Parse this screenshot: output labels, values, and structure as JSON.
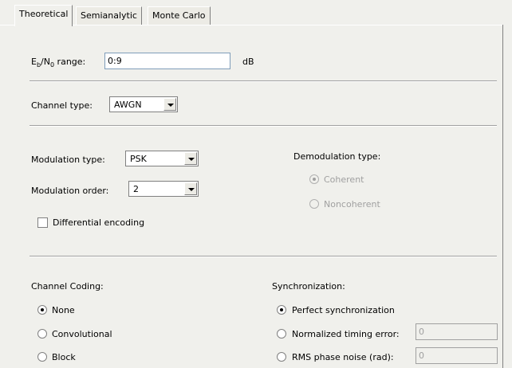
{
  "tabs": [
    {
      "label": "Theoretical",
      "active": true
    },
    {
      "label": "Semianalytic",
      "active": false
    },
    {
      "label": "Monte Carlo",
      "active": false
    }
  ],
  "ebno": {
    "label_E": "E",
    "label_b": "b",
    "label_N": "/N",
    "label_0": "0",
    "label_suffix": " range:",
    "value": "0:9",
    "unit": "dB"
  },
  "channel": {
    "label": "Channel type:",
    "value": "AWGN"
  },
  "modulation": {
    "type_label": "Modulation type:",
    "type_value": "PSK",
    "order_label": "Modulation order:",
    "order_value": "2",
    "differential_label": "Differential encoding",
    "differential_checked": false
  },
  "demodulation": {
    "title": "Demodulation type:",
    "options": [
      {
        "label": "Coherent",
        "selected": true
      },
      {
        "label": "Noncoherent",
        "selected": false
      }
    ]
  },
  "coding": {
    "title": "Channel Coding:",
    "options": [
      {
        "label": "None",
        "selected": true
      },
      {
        "label": "Convolutional",
        "selected": false
      },
      {
        "label": "Block",
        "selected": false
      }
    ]
  },
  "sync": {
    "title": "Synchronization:",
    "perfect_label": "Perfect synchronization",
    "timing_label": "Normalized timing error:",
    "timing_value": "0",
    "phase_label": "RMS phase noise (rad):",
    "phase_value": "0"
  }
}
